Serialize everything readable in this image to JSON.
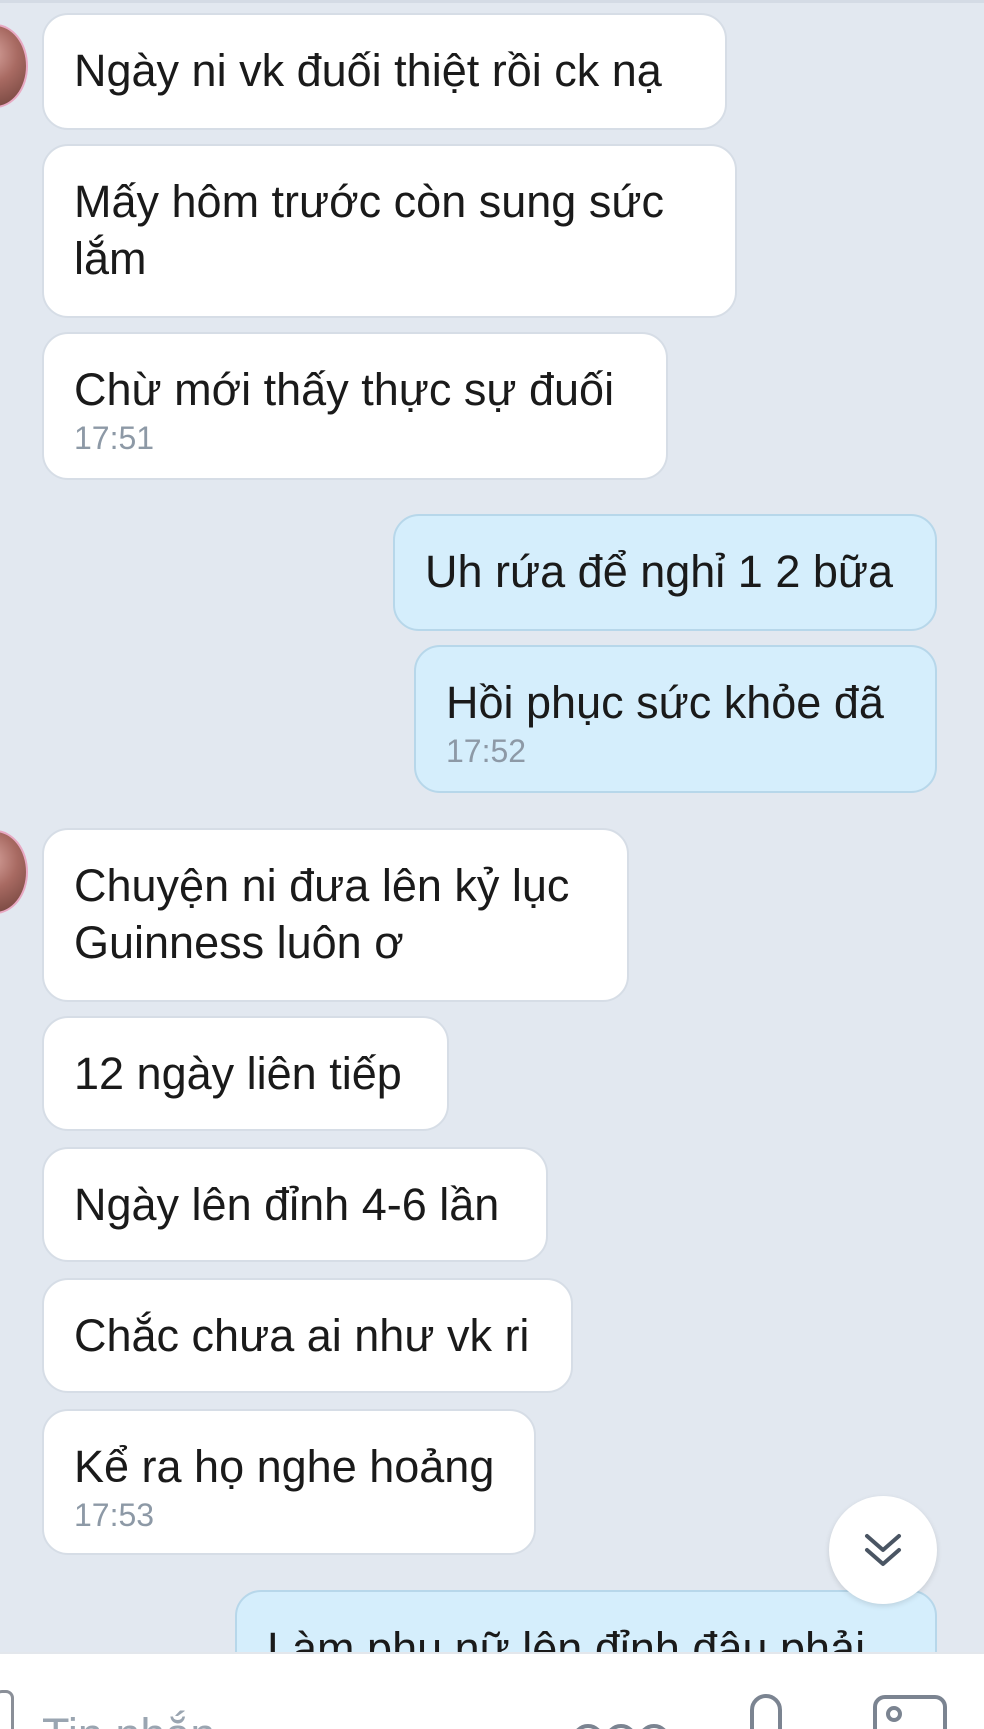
{
  "chat": {
    "messages": [
      {
        "id": "m1",
        "side": "in",
        "text": "Ngày ni vk đuối thiệt rồi ck nạ"
      },
      {
        "id": "m2",
        "side": "in",
        "text_line1": "Mấy hôm trước còn sung sức",
        "text_line2": "lắm"
      },
      {
        "id": "m3",
        "side": "in",
        "text": "Chừ mới thấy thực sự đuối",
        "time": "17:51"
      },
      {
        "id": "m4",
        "side": "out",
        "text": "Uh rứa để nghỉ 1 2 bữa"
      },
      {
        "id": "m5",
        "side": "out",
        "text": "Hồi phục sức khỏe đã",
        "time": "17:52"
      },
      {
        "id": "m6",
        "side": "in",
        "text_line1": "Chuyện ni đưa lên kỷ lục",
        "text_line2": "Guinness luôn ơ"
      },
      {
        "id": "m7",
        "side": "in",
        "text": "12 ngày liên tiếp"
      },
      {
        "id": "m8",
        "side": "in",
        "text": "Ngày lên đỉnh 4-6 lần"
      },
      {
        "id": "m9",
        "side": "in",
        "text": "Chắc chưa ai như vk ri"
      },
      {
        "id": "m10",
        "side": "in",
        "text": "Kể ra họ nghe hoảng",
        "time": "17:53"
      },
      {
        "id": "m11",
        "side": "out",
        "text": "Làm phụ nữ lên đỉnh đâu phải"
      }
    ]
  },
  "input_bar": {
    "placeholder": "Tin nhắn"
  },
  "icons": {
    "scroll_down": "chevron-double-down-icon",
    "emoji": "emoji-icon",
    "mic": "microphone-icon",
    "image": "image-icon"
  },
  "colors": {
    "background": "#e2e8f0",
    "incoming_bubble": "#ffffff",
    "outgoing_bubble": "#d5eefc",
    "timestamp": "#8d99a6"
  }
}
